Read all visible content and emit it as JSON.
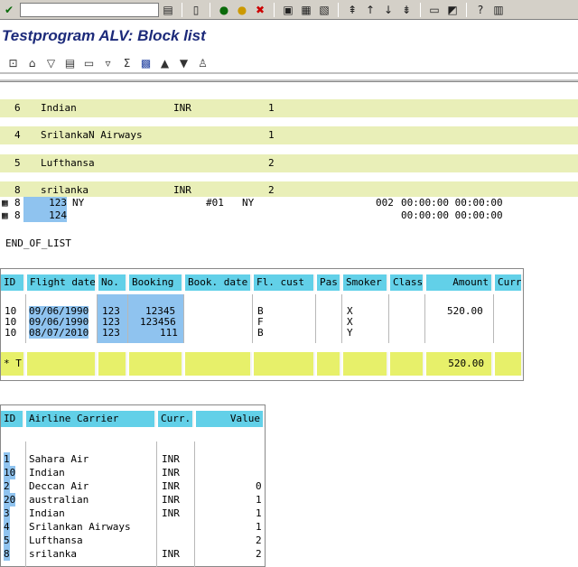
{
  "toolbar": {
    "command_field_value": "",
    "icons": [
      "check-icon",
      "dropdown-icon",
      "save-icon",
      "back-icon",
      "exit-icon",
      "cancel-icon",
      "print-icon",
      "find-icon",
      "find-next-icon",
      "first-page-icon",
      "previous-page-icon",
      "next-page-icon",
      "last-page-icon",
      "new-session-icon",
      "shortcut-icon",
      "help-icon",
      "layout-icon"
    ]
  },
  "title": "Testprogram  ALV: Block list",
  "app_toolbar": {
    "icons": [
      "details-icon",
      "print-preview-icon",
      "sort-ascending-icon",
      "sort-descending-icon",
      "find-icon",
      "filter-icon",
      "sum-icon",
      "export-icon",
      "sort-up-icon",
      "sort-down-icon",
      "layout-icon"
    ]
  },
  "block1": {
    "rows": [
      {
        "c1": "6",
        "c2": "Indian",
        "c3": "INR",
        "c4": "1"
      },
      {
        "c1": "4",
        "c2": "SrilankaN Airways",
        "c3": "",
        "c4": "1"
      },
      {
        "c1": "5",
        "c2": "Lufthansa",
        "c3": "",
        "c4": "2"
      },
      {
        "c1": "8",
        "c2": "srilanka",
        "c3": "INR",
        "c4": "2"
      }
    ],
    "detail_rows": [
      {
        "a": "8",
        "b": "123",
        "c": "NY",
        "d": "#01",
        "e": "NY",
        "f": "002",
        "g": "00:00:00  00:00:00"
      },
      {
        "a": "8",
        "b": "124",
        "c": "",
        "d": "",
        "e": "",
        "f": "",
        "g": "00:00:00  00:00:00"
      }
    ],
    "end_of_list": "END_OF_LIST"
  },
  "block2": {
    "headers": [
      "ID",
      "Flight date",
      "No.",
      "Booking",
      "Book. date",
      "Fl. cust",
      "Pas",
      "Smoker",
      "Class",
      "Amount",
      "Curr"
    ],
    "rows": [
      [
        "10",
        "09/06/1990",
        "123",
        "12345",
        "",
        "B",
        "",
        "X",
        "",
        "520.00",
        ""
      ],
      [
        "10",
        "09/06/1990",
        "123",
        "123456",
        "",
        "F",
        "",
        "X",
        "",
        "",
        ""
      ],
      [
        "10",
        "08/07/2010",
        "123",
        "111",
        "",
        "B",
        "",
        "Y",
        "",
        "",
        ""
      ]
    ],
    "total_label": "* T",
    "total_amount": "520.00"
  },
  "block3": {
    "headers": [
      "ID",
      "Airline Carrier",
      "Curr.",
      "Value"
    ],
    "rows": [
      {
        "id": "1",
        "name": "Sahara Air",
        "curr": "INR",
        "val": ""
      },
      {
        "id": "10",
        "name": "Indian",
        "curr": "INR",
        "val": ""
      },
      {
        "id": "2",
        "name": "Deccan Air",
        "curr": "INR",
        "val": "0"
      },
      {
        "id": "20",
        "name": "australian",
        "curr": "INR",
        "val": "1"
      },
      {
        "id": "3",
        "name": "Indian",
        "curr": "INR",
        "val": "1"
      },
      {
        "id": "4",
        "name": "Srilankan Airways",
        "curr": "",
        "val": "1"
      },
      {
        "id": "5",
        "name": "Lufthansa",
        "curr": "",
        "val": "2"
      },
      {
        "id": "8",
        "name": "srilanka",
        "curr": "INR",
        "val": "2"
      }
    ]
  }
}
